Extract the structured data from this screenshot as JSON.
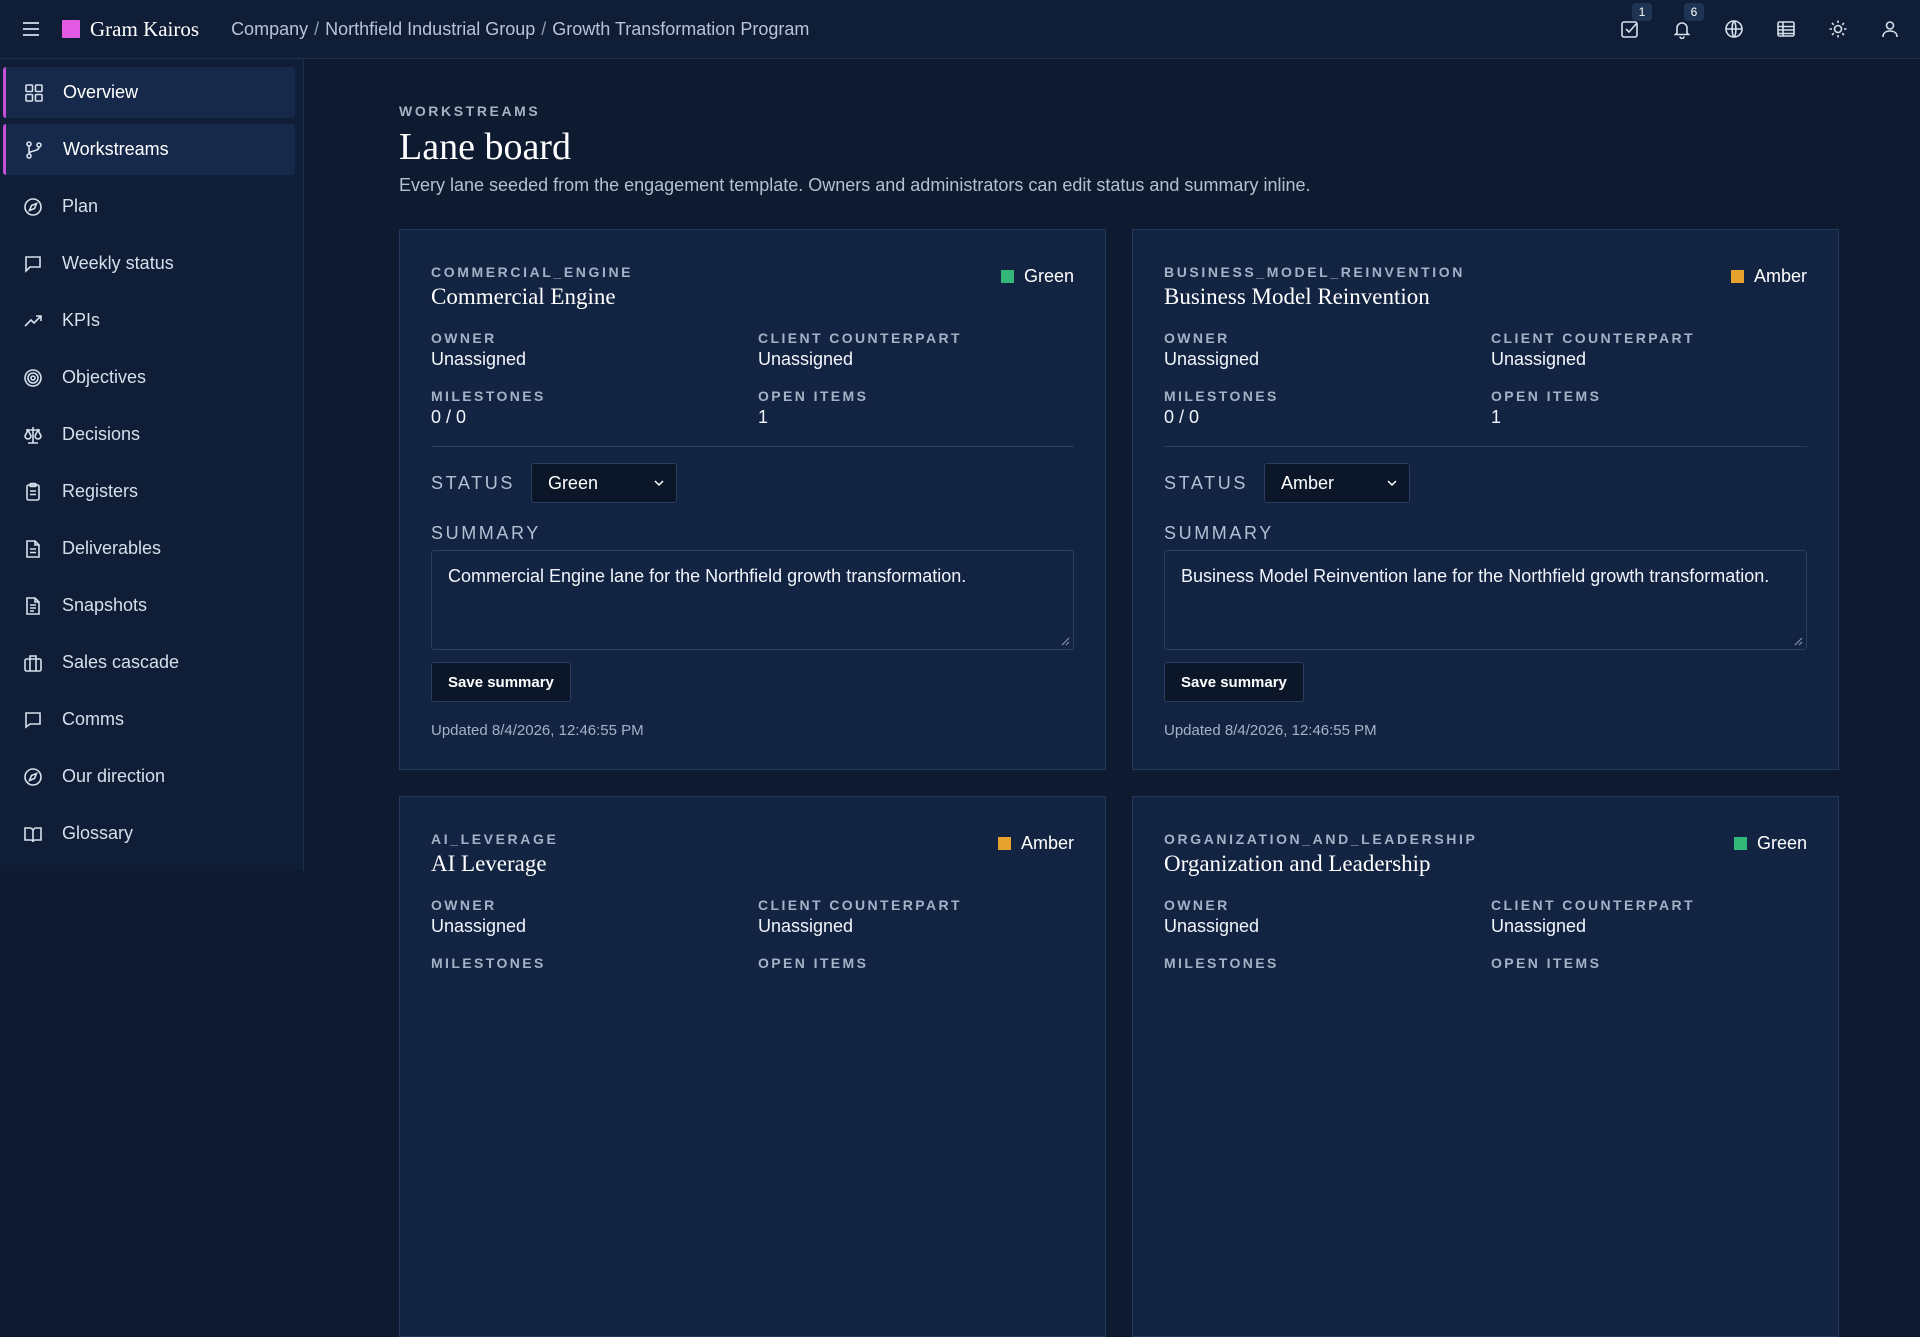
{
  "topbar": {
    "brand": "Gram Kairos",
    "brand_color": "#e35be3",
    "breadcrumb": [
      "Company",
      "Northfield Industrial Group",
      "Growth Transformation Program"
    ],
    "tasks_badge": "1",
    "notifications_badge": "6"
  },
  "sidebar": {
    "items": [
      {
        "label": "Overview",
        "icon": "grid-icon"
      },
      {
        "label": "Workstreams",
        "icon": "branch-icon"
      },
      {
        "label": "Plan",
        "icon": "compass-icon"
      },
      {
        "label": "Weekly status",
        "icon": "chat-icon"
      },
      {
        "label": "KPIs",
        "icon": "trending-up-icon"
      },
      {
        "label": "Objectives",
        "icon": "target-icon"
      },
      {
        "label": "Decisions",
        "icon": "scale-icon"
      },
      {
        "label": "Registers",
        "icon": "clipboard-icon"
      },
      {
        "label": "Deliverables",
        "icon": "file-icon"
      },
      {
        "label": "Snapshots",
        "icon": "file-text-icon"
      },
      {
        "label": "Sales cascade",
        "icon": "briefcase-icon"
      },
      {
        "label": "Comms",
        "icon": "message-icon"
      },
      {
        "label": "Our direction",
        "icon": "compass-icon"
      },
      {
        "label": "Glossary",
        "icon": "book-icon"
      }
    ]
  },
  "page": {
    "eyebrow": "WORKSTREAMS",
    "title": "Lane board",
    "description": "Every lane seeded from the engagement template. Owners and administrators can edit status and summary inline."
  },
  "labels": {
    "owner": "OWNER",
    "client_counterpart": "CLIENT COUNTERPART",
    "milestones": "MILESTONES",
    "open_items": "OPEN ITEMS",
    "status": "STATUS",
    "summary": "SUMMARY",
    "save": "Save summary"
  },
  "status_colors": {
    "Green": "#34b87a",
    "Amber": "#e5a32e"
  },
  "lanes": [
    {
      "code": "COMMERCIAL_ENGINE",
      "name": "Commercial Engine",
      "status": "Green",
      "owner": "Unassigned",
      "client_counterpart": "Unassigned",
      "milestones": "0 / 0",
      "open_items": "1",
      "summary": "Commercial Engine lane for the Northfield growth transformation.",
      "updated": "Updated 8/4/2026, 12:46:55 PM"
    },
    {
      "code": "BUSINESS_MODEL_REINVENTION",
      "name": "Business Model Reinvention",
      "status": "Amber",
      "owner": "Unassigned",
      "client_counterpart": "Unassigned",
      "milestones": "0 / 0",
      "open_items": "1",
      "summary": "Business Model Reinvention lane for the Northfield growth transformation.",
      "updated": "Updated 8/4/2026, 12:46:55 PM"
    },
    {
      "code": "AI_LEVERAGE",
      "name": "AI Leverage",
      "status": "Amber",
      "owner": "Unassigned",
      "client_counterpart": "Unassigned"
    },
    {
      "code": "ORGANIZATION_AND_LEADERSHIP",
      "name": "Organization and Leadership",
      "status": "Green",
      "owner": "Unassigned",
      "client_counterpart": "Unassigned"
    }
  ]
}
